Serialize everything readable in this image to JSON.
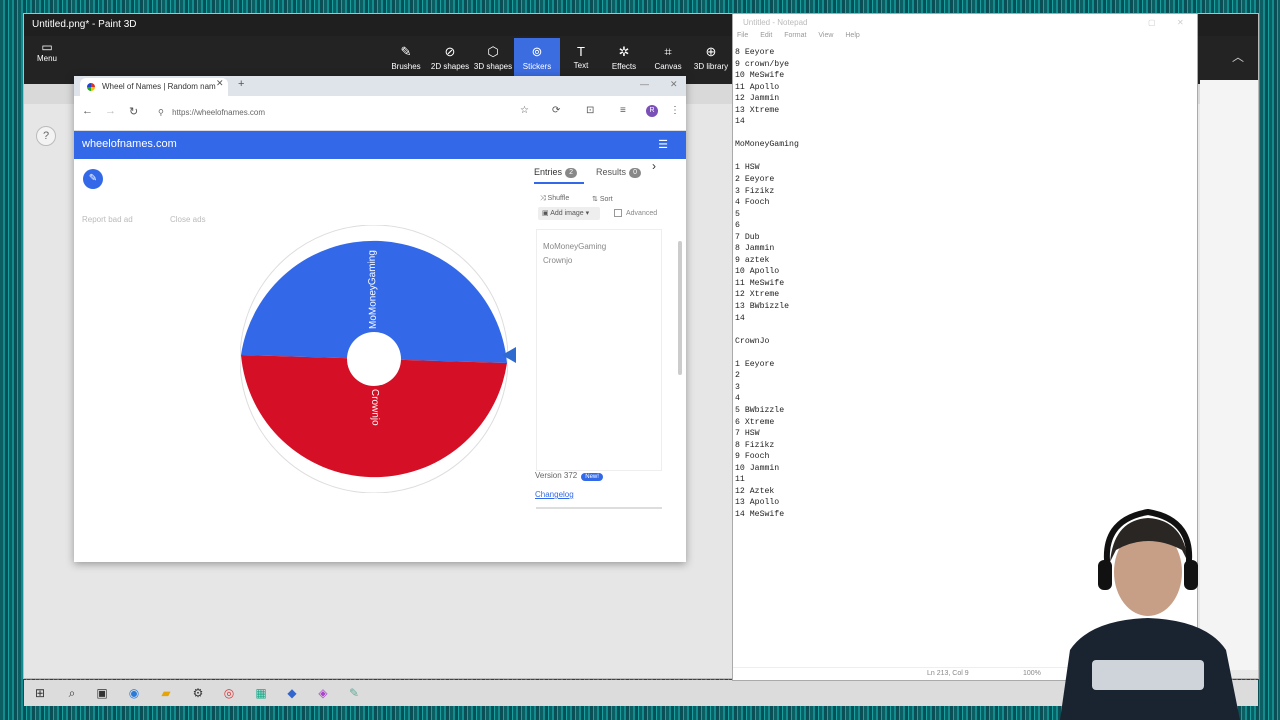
{
  "paint": {
    "title": "Untitled.png* - Paint 3D",
    "menu_label": "Menu",
    "tools": [
      {
        "label": "Brushes",
        "icon": "brush-icon"
      },
      {
        "label": "2D shapes",
        "icon": "2d-shapes-icon"
      },
      {
        "label": "3D shapes",
        "icon": "3d-shapes-icon"
      },
      {
        "label": "Stickers",
        "icon": "stickers-icon"
      },
      {
        "label": "Text",
        "icon": "text-icon"
      },
      {
        "label": "Effects",
        "icon": "effects-icon"
      },
      {
        "label": "Canvas",
        "icon": "canvas-icon"
      },
      {
        "label": "3D library",
        "icon": "3d-library-icon"
      }
    ],
    "active_tool": "Stickers"
  },
  "browser": {
    "tab_title": "Wheel of Names | Random nam",
    "url": "https://wheelofnames.com"
  },
  "site": {
    "title": "wheelofnames.com",
    "faded_left": "Report bad ad",
    "faded_right": "Close ads",
    "entries_tab": "Entries",
    "entries_count": "2",
    "results_tab": "Results",
    "results_count": "0",
    "shuffle": "Shuffle",
    "sort": "Sort",
    "add_image": "Add image",
    "advanced": "Advanced",
    "entries": [
      "MoMoneyGaming",
      "Crownjo"
    ],
    "wheel_slices": [
      {
        "label": "MoMoneyGaming",
        "color": "#3369e8"
      },
      {
        "label": "Crownjo",
        "color": "#d50f25"
      }
    ],
    "version": "Version 372",
    "new_badge": "New!",
    "changelog": "Changelog"
  },
  "notepad": {
    "title": "Untitled - Notepad",
    "menu": [
      "File",
      "Edit",
      "Format",
      "View",
      "Help"
    ],
    "lines": [
      "8 Eeyore",
      "9 crown/bye",
      "10 MeSwife",
      "11 Apollo",
      "12 Jammin",
      "13 Xtreme",
      "14",
      "",
      "MoMoneyGaming",
      "",
      "1 HSW",
      "2 Eeyore",
      "3 Fizikz",
      "4 Fooch",
      "5",
      "6",
      "7 Dub",
      "8 Jammin",
      "9 aztek",
      "10 Apollo",
      "11 MeSwife",
      "12 Xtreme",
      "13 BWbizzle",
      "14",
      "",
      "CrownJo",
      "",
      "1 Eeyore",
      "2",
      "3",
      "4",
      "5 BWbizzle",
      "6 Xtreme",
      "7 HSW",
      "8 Fizikz",
      "9 Fooch",
      "10 Jammin",
      "11",
      "12 Aztek",
      "13 Apollo",
      "14 MeSwife"
    ],
    "status_pos": "Ln 213, Col 9",
    "status_zoom": "100%"
  }
}
